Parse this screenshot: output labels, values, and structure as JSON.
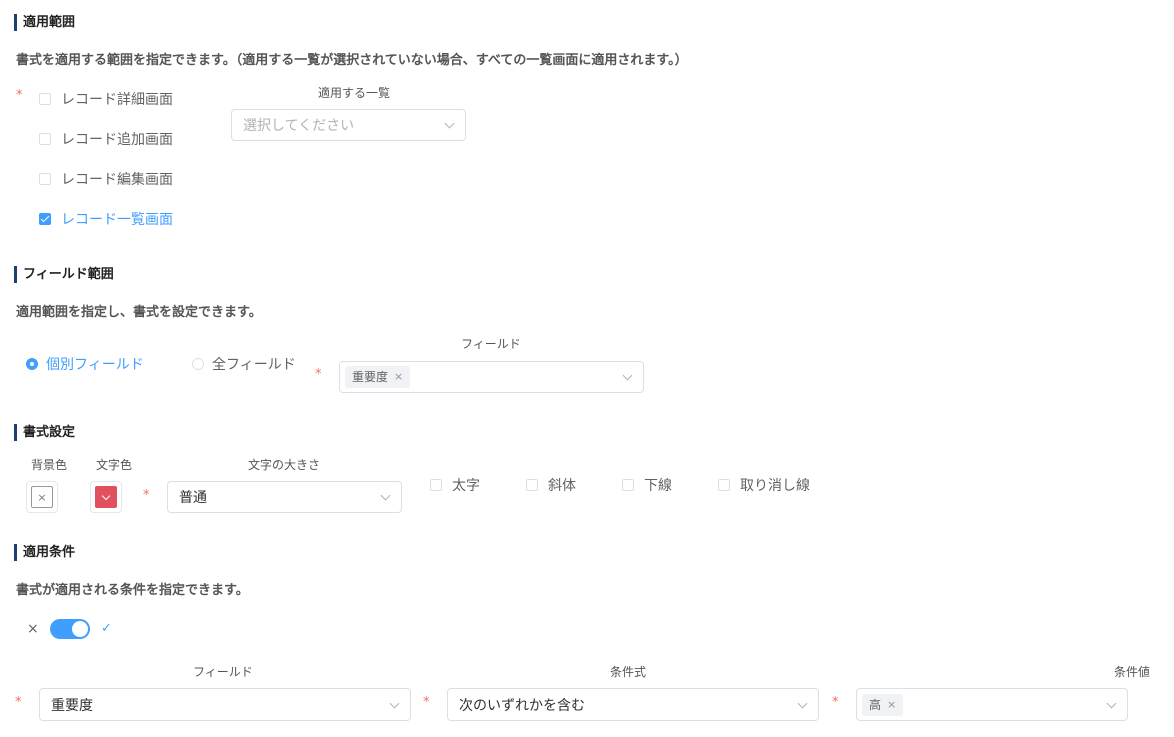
{
  "scope": {
    "title": "適用範囲",
    "description": "書式を適用する範囲を指定できます。（適用する一覧が選択されていない場合、すべての一覧画面に適用されます。）",
    "required_mark": "*",
    "options": [
      {
        "label": "レコード詳細画面",
        "checked": false
      },
      {
        "label": "レコード追加画面",
        "checked": false
      },
      {
        "label": "レコード編集画面",
        "checked": false
      },
      {
        "label": "レコード一覧画面",
        "checked": true
      }
    ],
    "list_label": "適用する一覧",
    "list_placeholder": "選択してください"
  },
  "field_scope": {
    "title": "フィールド範囲",
    "description": "適用範囲を指定し、書式を設定できます。",
    "radio_individual": "個別フィールド",
    "radio_all": "全フィールド",
    "selected_radio": "個別フィールド",
    "field_label": "フィールド",
    "required_mark": "*",
    "selected_tag": "重要度",
    "tag_close": "×"
  },
  "format": {
    "title": "書式設定",
    "bg_label": "背景色",
    "text_color_label": "文字色",
    "text_color_hex": "#e0505e",
    "size_label": "文字の大きさ",
    "required_mark": "*",
    "size_value": "普通",
    "none_icon": "×",
    "styles": [
      {
        "label": "太字",
        "checked": false
      },
      {
        "label": "斜体",
        "checked": false
      },
      {
        "label": "下線",
        "checked": false
      },
      {
        "label": "取り消し線",
        "checked": false
      }
    ]
  },
  "conditions": {
    "title": "適用条件",
    "description": "書式が適用される条件を指定できます。",
    "switch_off_icon": "×",
    "switch_on_icon": "✓",
    "switch_on": true,
    "field_label": "フィールド",
    "op_label": "条件式",
    "value_label": "条件値",
    "required_mark": "*",
    "field_value": "重要度",
    "op_value": "次のいずれかを含む",
    "value_tag": "高",
    "tag_close": "×"
  },
  "colors": {
    "accent": "#409eff",
    "section_bar": "#1f3f73",
    "required": "#f56c6c"
  }
}
